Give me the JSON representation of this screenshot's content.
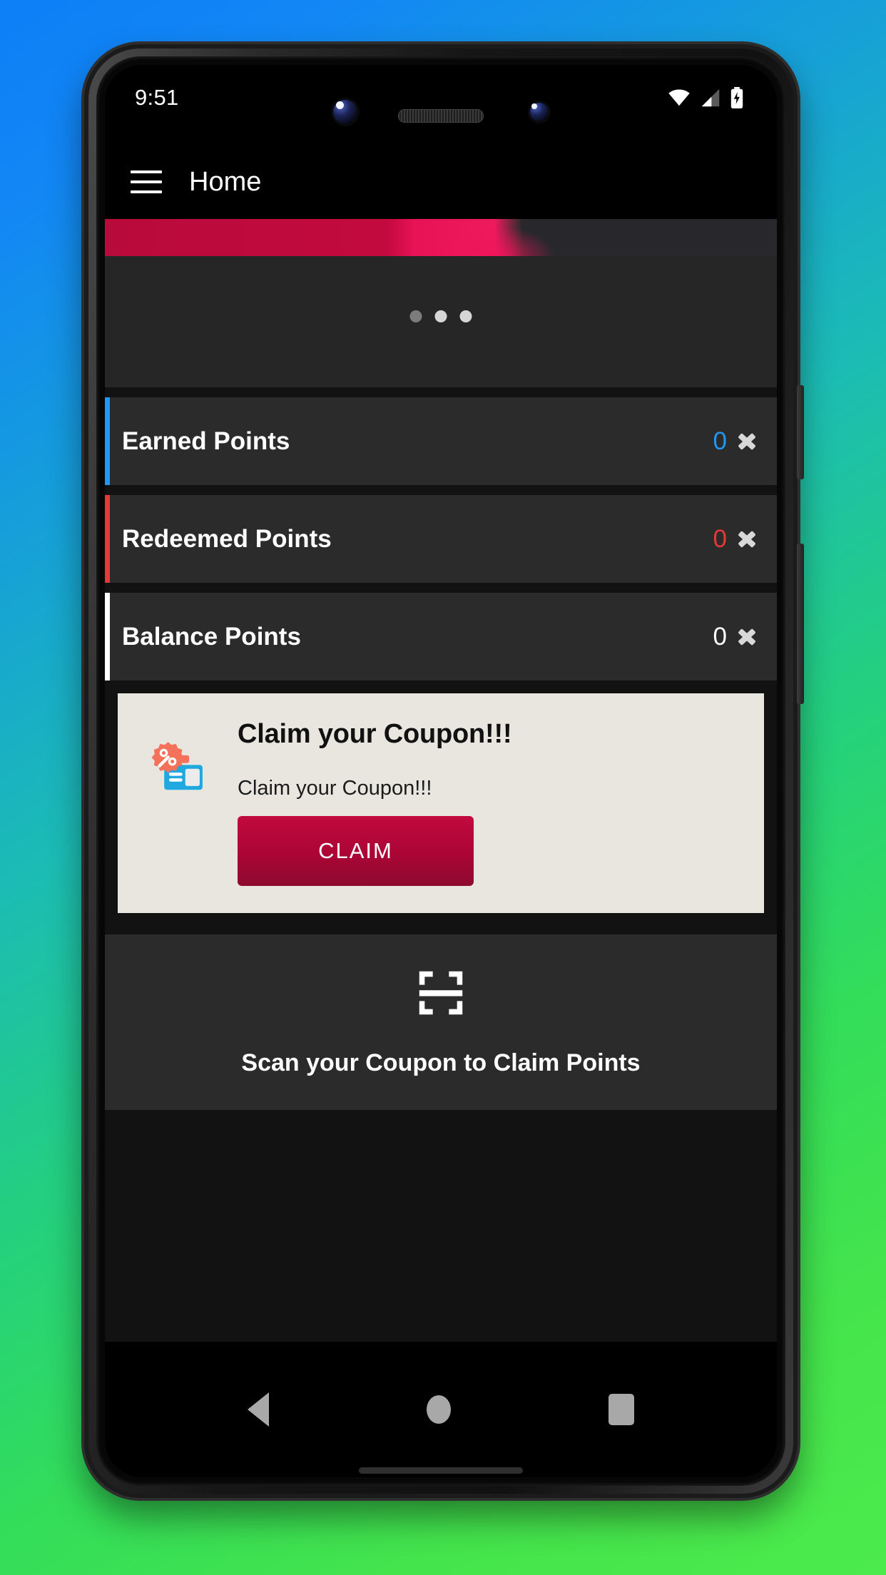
{
  "theme": {
    "bg_gradient_from": "#0d7ff7",
    "bg_gradient_to": "#4ceb4c",
    "screen_bg": "#121212",
    "card_bg": "#2b2b2b",
    "coupon_card_bg": "#e9e6e0",
    "accent_crimson": "#b90a3c",
    "accent_pink": "#ed1a5e",
    "earned_color": "#2196f3",
    "redeemed_color": "#e53935",
    "balance_color": "#ffffff"
  },
  "statusbar": {
    "time": "9:51",
    "icons": [
      "wifi-icon",
      "cellular-signal-icon",
      "battery-charging-icon"
    ]
  },
  "appbar": {
    "menu_icon": "hamburger-menu-icon",
    "title": "Home"
  },
  "carousel": {
    "slide_count": 3,
    "active_index": 0,
    "dots": [
      "",
      "",
      ""
    ]
  },
  "points": [
    {
      "label": "Earned Points",
      "value": "0",
      "bar_color": "#2196f3",
      "value_color": "#2196f3",
      "name": "earned-points"
    },
    {
      "label": "Redeemed Points",
      "value": "0",
      "bar_color": "#e53935",
      "value_color": "#e53935",
      "name": "redeemed-points"
    },
    {
      "label": "Balance Points",
      "value": "0",
      "bar_color": "#ffffff",
      "value_color": "#ffffff",
      "name": "balance-points"
    }
  ],
  "coupon": {
    "icon": "coupon-discount-icon",
    "title": "Claim your Coupon!!!",
    "subtitle": "Claim your Coupon!!!",
    "button_label": "CLAIM"
  },
  "scan": {
    "icon": "barcode-scan-icon",
    "label": "Scan your Coupon to Claim Points"
  },
  "navbar": {
    "back": "back-triangle-icon",
    "home": "home-circle-icon",
    "recents": "recents-square-icon"
  }
}
